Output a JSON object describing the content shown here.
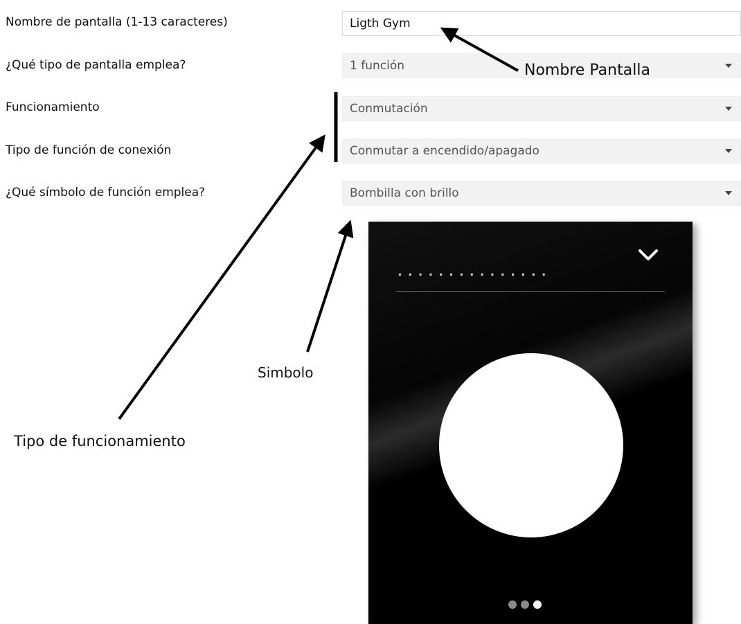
{
  "form": {
    "rows": [
      {
        "label": "Nombre de pantalla (1-13 caracteres)",
        "value": "Ligth Gym",
        "kind": "text"
      },
      {
        "label": "¿Qué tipo de pantalla emplea?",
        "value": "1 función",
        "kind": "select"
      },
      {
        "label": "Funcionamiento",
        "value": "Conmutación",
        "kind": "select"
      },
      {
        "label": "Tipo de función de conexión",
        "value": "Conmutar a encendido/apagado",
        "kind": "select"
      },
      {
        "label": "¿Qué símbolo de función emplea?",
        "value": "Bombilla con brillo",
        "kind": "select"
      }
    ]
  },
  "annotations": {
    "nombre_pantalla": "Nombre Pantalla",
    "simbolo": "Simbolo",
    "tipo_funcionamiento": "Tipo de funcionamiento"
  },
  "device_preview": {
    "name_placeholder": "...............",
    "icons": {
      "top_right": "chevron-down-icon",
      "main": "light-bulb-symbol"
    },
    "pager": {
      "count": 3,
      "active_index": 2
    },
    "colors": {
      "background": "#000000",
      "symbol": "#ffffff",
      "pager_inactive": "#8a8a8a",
      "pager_active": "#ffffff"
    }
  }
}
